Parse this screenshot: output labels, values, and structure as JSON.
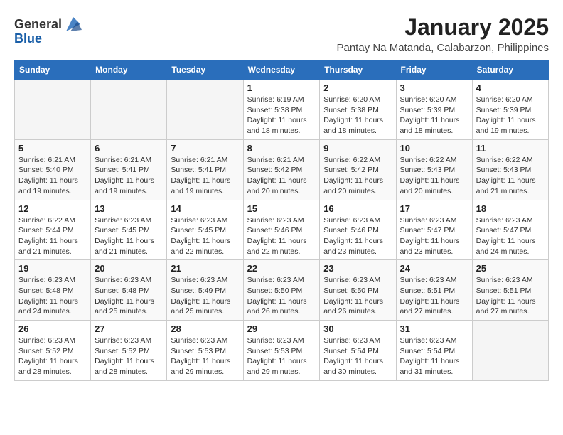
{
  "header": {
    "logo_general": "General",
    "logo_blue": "Blue",
    "main_title": "January 2025",
    "subtitle": "Pantay Na Matanda, Calabarzon, Philippines"
  },
  "calendar": {
    "days_of_week": [
      "Sunday",
      "Monday",
      "Tuesday",
      "Wednesday",
      "Thursday",
      "Friday",
      "Saturday"
    ],
    "weeks": [
      [
        {
          "day": "",
          "sunrise": "",
          "sunset": "",
          "daylight": ""
        },
        {
          "day": "",
          "sunrise": "",
          "sunset": "",
          "daylight": ""
        },
        {
          "day": "",
          "sunrise": "",
          "sunset": "",
          "daylight": ""
        },
        {
          "day": "1",
          "sunrise": "Sunrise: 6:19 AM",
          "sunset": "Sunset: 5:38 PM",
          "daylight": "Daylight: 11 hours and 18 minutes."
        },
        {
          "day": "2",
          "sunrise": "Sunrise: 6:20 AM",
          "sunset": "Sunset: 5:38 PM",
          "daylight": "Daylight: 11 hours and 18 minutes."
        },
        {
          "day": "3",
          "sunrise": "Sunrise: 6:20 AM",
          "sunset": "Sunset: 5:39 PM",
          "daylight": "Daylight: 11 hours and 18 minutes."
        },
        {
          "day": "4",
          "sunrise": "Sunrise: 6:20 AM",
          "sunset": "Sunset: 5:39 PM",
          "daylight": "Daylight: 11 hours and 19 minutes."
        }
      ],
      [
        {
          "day": "5",
          "sunrise": "Sunrise: 6:21 AM",
          "sunset": "Sunset: 5:40 PM",
          "daylight": "Daylight: 11 hours and 19 minutes."
        },
        {
          "day": "6",
          "sunrise": "Sunrise: 6:21 AM",
          "sunset": "Sunset: 5:41 PM",
          "daylight": "Daylight: 11 hours and 19 minutes."
        },
        {
          "day": "7",
          "sunrise": "Sunrise: 6:21 AM",
          "sunset": "Sunset: 5:41 PM",
          "daylight": "Daylight: 11 hours and 19 minutes."
        },
        {
          "day": "8",
          "sunrise": "Sunrise: 6:21 AM",
          "sunset": "Sunset: 5:42 PM",
          "daylight": "Daylight: 11 hours and 20 minutes."
        },
        {
          "day": "9",
          "sunrise": "Sunrise: 6:22 AM",
          "sunset": "Sunset: 5:42 PM",
          "daylight": "Daylight: 11 hours and 20 minutes."
        },
        {
          "day": "10",
          "sunrise": "Sunrise: 6:22 AM",
          "sunset": "Sunset: 5:43 PM",
          "daylight": "Daylight: 11 hours and 20 minutes."
        },
        {
          "day": "11",
          "sunrise": "Sunrise: 6:22 AM",
          "sunset": "Sunset: 5:43 PM",
          "daylight": "Daylight: 11 hours and 21 minutes."
        }
      ],
      [
        {
          "day": "12",
          "sunrise": "Sunrise: 6:22 AM",
          "sunset": "Sunset: 5:44 PM",
          "daylight": "Daylight: 11 hours and 21 minutes."
        },
        {
          "day": "13",
          "sunrise": "Sunrise: 6:23 AM",
          "sunset": "Sunset: 5:45 PM",
          "daylight": "Daylight: 11 hours and 21 minutes."
        },
        {
          "day": "14",
          "sunrise": "Sunrise: 6:23 AM",
          "sunset": "Sunset: 5:45 PM",
          "daylight": "Daylight: 11 hours and 22 minutes."
        },
        {
          "day": "15",
          "sunrise": "Sunrise: 6:23 AM",
          "sunset": "Sunset: 5:46 PM",
          "daylight": "Daylight: 11 hours and 22 minutes."
        },
        {
          "day": "16",
          "sunrise": "Sunrise: 6:23 AM",
          "sunset": "Sunset: 5:46 PM",
          "daylight": "Daylight: 11 hours and 23 minutes."
        },
        {
          "day": "17",
          "sunrise": "Sunrise: 6:23 AM",
          "sunset": "Sunset: 5:47 PM",
          "daylight": "Daylight: 11 hours and 23 minutes."
        },
        {
          "day": "18",
          "sunrise": "Sunrise: 6:23 AM",
          "sunset": "Sunset: 5:47 PM",
          "daylight": "Daylight: 11 hours and 24 minutes."
        }
      ],
      [
        {
          "day": "19",
          "sunrise": "Sunrise: 6:23 AM",
          "sunset": "Sunset: 5:48 PM",
          "daylight": "Daylight: 11 hours and 24 minutes."
        },
        {
          "day": "20",
          "sunrise": "Sunrise: 6:23 AM",
          "sunset": "Sunset: 5:48 PM",
          "daylight": "Daylight: 11 hours and 25 minutes."
        },
        {
          "day": "21",
          "sunrise": "Sunrise: 6:23 AM",
          "sunset": "Sunset: 5:49 PM",
          "daylight": "Daylight: 11 hours and 25 minutes."
        },
        {
          "day": "22",
          "sunrise": "Sunrise: 6:23 AM",
          "sunset": "Sunset: 5:50 PM",
          "daylight": "Daylight: 11 hours and 26 minutes."
        },
        {
          "day": "23",
          "sunrise": "Sunrise: 6:23 AM",
          "sunset": "Sunset: 5:50 PM",
          "daylight": "Daylight: 11 hours and 26 minutes."
        },
        {
          "day": "24",
          "sunrise": "Sunrise: 6:23 AM",
          "sunset": "Sunset: 5:51 PM",
          "daylight": "Daylight: 11 hours and 27 minutes."
        },
        {
          "day": "25",
          "sunrise": "Sunrise: 6:23 AM",
          "sunset": "Sunset: 5:51 PM",
          "daylight": "Daylight: 11 hours and 27 minutes."
        }
      ],
      [
        {
          "day": "26",
          "sunrise": "Sunrise: 6:23 AM",
          "sunset": "Sunset: 5:52 PM",
          "daylight": "Daylight: 11 hours and 28 minutes."
        },
        {
          "day": "27",
          "sunrise": "Sunrise: 6:23 AM",
          "sunset": "Sunset: 5:52 PM",
          "daylight": "Daylight: 11 hours and 28 minutes."
        },
        {
          "day": "28",
          "sunrise": "Sunrise: 6:23 AM",
          "sunset": "Sunset: 5:53 PM",
          "daylight": "Daylight: 11 hours and 29 minutes."
        },
        {
          "day": "29",
          "sunrise": "Sunrise: 6:23 AM",
          "sunset": "Sunset: 5:53 PM",
          "daylight": "Daylight: 11 hours and 29 minutes."
        },
        {
          "day": "30",
          "sunrise": "Sunrise: 6:23 AM",
          "sunset": "Sunset: 5:54 PM",
          "daylight": "Daylight: 11 hours and 30 minutes."
        },
        {
          "day": "31",
          "sunrise": "Sunrise: 6:23 AM",
          "sunset": "Sunset: 5:54 PM",
          "daylight": "Daylight: 11 hours and 31 minutes."
        },
        {
          "day": "",
          "sunrise": "",
          "sunset": "",
          "daylight": ""
        }
      ]
    ]
  }
}
